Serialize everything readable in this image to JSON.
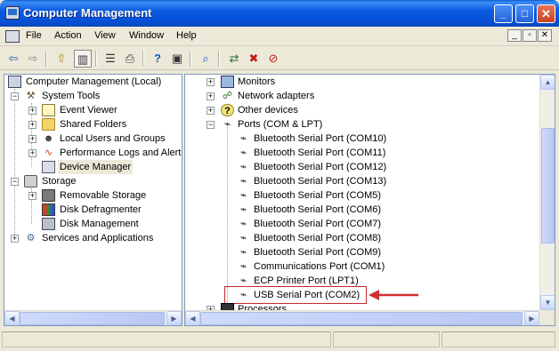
{
  "window": {
    "title": "Computer Management",
    "buttons": {
      "minimize": "_",
      "maximize": "□",
      "close": "✕"
    }
  },
  "menu": {
    "items": [
      "File",
      "Action",
      "View",
      "Window",
      "Help"
    ],
    "mdi_buttons": [
      "_",
      "▫",
      "✕"
    ]
  },
  "toolbar": {
    "buttons": [
      "back-icon",
      "forward-icon",
      "up-folder-icon",
      "show-hide-tree-icon",
      "properties-icon",
      "print-icon",
      "help-icon",
      "help-topics-icon",
      "scan-hardware-icon",
      "update-driver-icon",
      "uninstall-icon",
      "disable-icon"
    ],
    "glyphs": {
      "back": "⇦",
      "forward": "⇨",
      "up": "⇧",
      "tree": "▥",
      "props": "☰",
      "print": "⎙",
      "help": "?",
      "topics": "▣",
      "scan": "⌕",
      "update": "⇄",
      "uninstall": "✖",
      "disable": "⊘"
    }
  },
  "left_tree": [
    {
      "label": "Computer Management (Local)",
      "icon": "computer-icon",
      "level": 0
    },
    {
      "label": "System Tools",
      "icon": "tools-icon",
      "level": 1,
      "expanded": true
    },
    {
      "label": "Event Viewer",
      "icon": "event-viewer-icon",
      "level": 2,
      "expander": "+"
    },
    {
      "label": "Shared Folders",
      "icon": "folder-icon",
      "level": 2,
      "expander": "+"
    },
    {
      "label": "Local Users and Groups",
      "icon": "users-icon",
      "level": 2,
      "expander": "+"
    },
    {
      "label": "Performance Logs and Alerts",
      "icon": "performance-icon",
      "level": 2,
      "expander": "+"
    },
    {
      "label": "Device Manager",
      "icon": "device-manager-icon",
      "level": 2,
      "selected": true
    },
    {
      "label": "Storage",
      "icon": "storage-icon",
      "level": 1,
      "expanded": true
    },
    {
      "label": "Removable Storage",
      "icon": "removable-storage-icon",
      "level": 2,
      "expander": "+"
    },
    {
      "label": "Disk Defragmenter",
      "icon": "defrag-icon",
      "level": 2
    },
    {
      "label": "Disk Management",
      "icon": "disk-icon",
      "level": 2
    },
    {
      "label": "Services and Applications",
      "icon": "services-icon",
      "level": 1,
      "expander": "+"
    }
  ],
  "right_tree": [
    {
      "label": "Monitors",
      "icon": "monitor-icon",
      "expander": "+"
    },
    {
      "label": "Network adapters",
      "icon": "network-icon",
      "expander": "+"
    },
    {
      "label": "Other devices",
      "icon": "other-devices-icon",
      "expander": "+"
    },
    {
      "label": "Ports (COM & LPT)",
      "icon": "port-icon",
      "expander": "−"
    },
    {
      "label": "Bluetooth Serial Port (COM10)",
      "icon": "port-icon",
      "child": true
    },
    {
      "label": "Bluetooth Serial Port (COM11)",
      "icon": "port-icon",
      "child": true
    },
    {
      "label": "Bluetooth Serial Port (COM12)",
      "icon": "port-icon",
      "child": true
    },
    {
      "label": "Bluetooth Serial Port (COM13)",
      "icon": "port-icon",
      "child": true
    },
    {
      "label": "Bluetooth Serial Port (COM5)",
      "icon": "port-icon",
      "child": true
    },
    {
      "label": "Bluetooth Serial Port (COM6)",
      "icon": "port-icon",
      "child": true
    },
    {
      "label": "Bluetooth Serial Port (COM7)",
      "icon": "port-icon",
      "child": true
    },
    {
      "label": "Bluetooth Serial Port (COM8)",
      "icon": "port-icon",
      "child": true
    },
    {
      "label": "Bluetooth Serial Port (COM9)",
      "icon": "port-icon",
      "child": true
    },
    {
      "label": "Communications Port (COM1)",
      "icon": "port-icon",
      "child": true
    },
    {
      "label": "ECP Printer Port (LPT1)",
      "icon": "port-icon",
      "child": true
    },
    {
      "label": "USB Serial Port (COM2)",
      "icon": "port-icon",
      "child": true,
      "highlighted": true
    },
    {
      "label": "Processors",
      "icon": "processor-icon",
      "expander": "+"
    }
  ],
  "annotation": {
    "arrow_color": "#d03030",
    "box_color": "#c62a2a"
  },
  "scroll": {
    "up": "▲",
    "down": "▼",
    "left": "◀",
    "right": "▶"
  }
}
